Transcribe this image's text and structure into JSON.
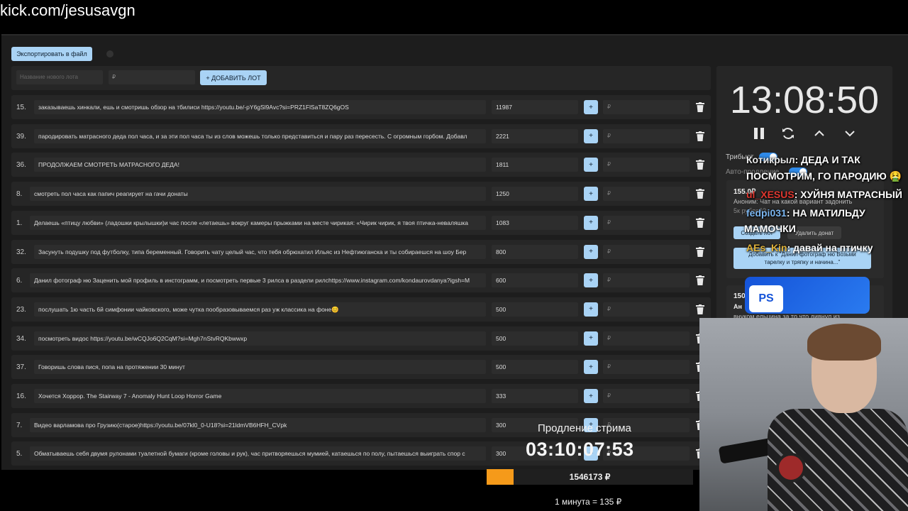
{
  "url": "kick.com/jesusavgn",
  "toolbar": {
    "export_label": "Экспортировать в файл"
  },
  "new_lot": {
    "name_placeholder": "Название нового лота",
    "amount_placeholder": "₽",
    "add_label": "+ ДОБАВИТЬ ЛОТ"
  },
  "lots": [
    {
      "num": "15.",
      "title": "заказываешь хинкали, ешь и смотришь обзор на тбилиси https://youtu.be/-pY6gSl9Avc?si=PRZ1FlSaT8ZQ6gOS",
      "amount": "11987",
      "plus": "+",
      "rub": "₽"
    },
    {
      "num": "39.",
      "title": "пародировать матрасного деда пол часа, и за эти пол часа ты из слов можешь только представиться и пару раз пересесть. С огромным горбом. Добавл",
      "amount": "2221",
      "plus": "+",
      "rub": "₽"
    },
    {
      "num": "36.",
      "title": "ПРОДОЛЖАЕМ СМОТРЕТЬ МАТРАСНОГО ДЕДА!",
      "amount": "1811",
      "plus": "+",
      "rub": "₽"
    },
    {
      "num": "8.",
      "title": "смотреть пол часа как папич реагирует на гачи донаты",
      "amount": "1250",
      "plus": "+",
      "rub": "₽"
    },
    {
      "num": "1.",
      "title": "Делаешь «птицу любви» (ладошки крылышки)и час после «летаешь» вокруг камеры прыжками на месте чирикая: «Чирик чирик, я твоя птичка-неваляшка",
      "amount": "1083",
      "plus": "+",
      "rub": "₽"
    },
    {
      "num": "32.",
      "title": "Засунуть подушку под футболку, типа беременный. Говорить чату целый час, что тебя обрюхатил Ильяс из Нефтиюганска и ты собираешся на шоу Бер",
      "amount": "800",
      "plus": "+",
      "rub": "₽"
    },
    {
      "num": "6.",
      "title": "Данил фотограф ню Заценить мой профиль в инстограмм, и посмотреть первые 3 рилса в раздели рилсhttps://www.instagram.com/kondaurovdanya?igsh=M",
      "amount": "600",
      "plus": "+",
      "rub": "₽"
    },
    {
      "num": "23.",
      "title": "послушать 1ю часть 6й симфонии чайковского, може чутка пообразовываемся раз уж классика на фоне😊",
      "amount": "500",
      "plus": "+",
      "rub": "₽"
    },
    {
      "num": "34.",
      "title": "посмотреть видос https://youtu.be/wCQJo6Q2CqM?si=Mgh7nStvRQKbwwxp",
      "amount": "500",
      "plus": "+",
      "rub": "₽"
    },
    {
      "num": "37.",
      "title": "Говоришь слова пися, попа на протяжении 30 минут",
      "amount": "500",
      "plus": "+",
      "rub": "₽"
    },
    {
      "num": "16.",
      "title": "Хочется Хоррор. The Stairway 7 - Anomaly Hunt Loop Horror Game",
      "amount": "333",
      "plus": "+",
      "rub": "₽"
    },
    {
      "num": "7.",
      "title": "Видео варламова про Грузию(старое)https://youtu.be/07kl0_0-U18?si=21ldmVB6HFH_CVpk",
      "amount": "300",
      "plus": "+",
      "rub": "₽"
    },
    {
      "num": "5.",
      "title": "Обматываешь себя двумя рулонами туалетной бумаги (кроме головы и рук), час притворяешься мумией, катаешься по полу, пытаешься выиграть спор с",
      "amount": "300",
      "plus": "+",
      "rub": "₽"
    }
  ],
  "timer": {
    "clock": "13:08:50",
    "tribute_label": "Трибьют",
    "auto_label": "Авто-продление"
  },
  "donation": {
    "amount": "155.0₽",
    "from": "Аноним: Чат на какой вариант задонить",
    "sub": "5к рублей?",
    "btn_create": "Создать лот",
    "btn_delete": "Удалить донат",
    "btn_add": "Добавить к \"Данил фотограф ню Возьми тарелку и тряпку и начина...\""
  },
  "donation2": {
    "amount": "150",
    "from": "Ан",
    "text": "внуком ельцина за то что дивнул из"
  },
  "ps_badge": "PS",
  "chat": [
    {
      "user": "Котикрыл",
      "user_color": "#e8e8e8",
      "text": ": ДЕДА И ТАК"
    },
    {
      "user": "",
      "user_color": "#ffffff",
      "text": "ПОСМОТРИМ, ГО ПАРОДИЮ 🤮"
    },
    {
      "user": "ul_XESUS",
      "user_color": "#e0372f",
      "text": ": ХУЙНЯ МАТРАСНЫЙ"
    },
    {
      "user": "fedpi031",
      "user_color": "#7bb6f0",
      "text": ": НА МАТИЛЬДУ"
    },
    {
      "user": "",
      "user_color": "#ffffff",
      "text": "МАМОЧКИ"
    },
    {
      "user": "AEs_Kin",
      "user_color": "#e0b23a",
      "text": ": давай на птичку"
    }
  ],
  "extension": {
    "label": "Продление стрима",
    "time": "03:10:07:53"
  },
  "progress": {
    "total": "1546173 ₽",
    "fill_fraction": 0.13
  },
  "rate": "1 минута = 135 ₽"
}
